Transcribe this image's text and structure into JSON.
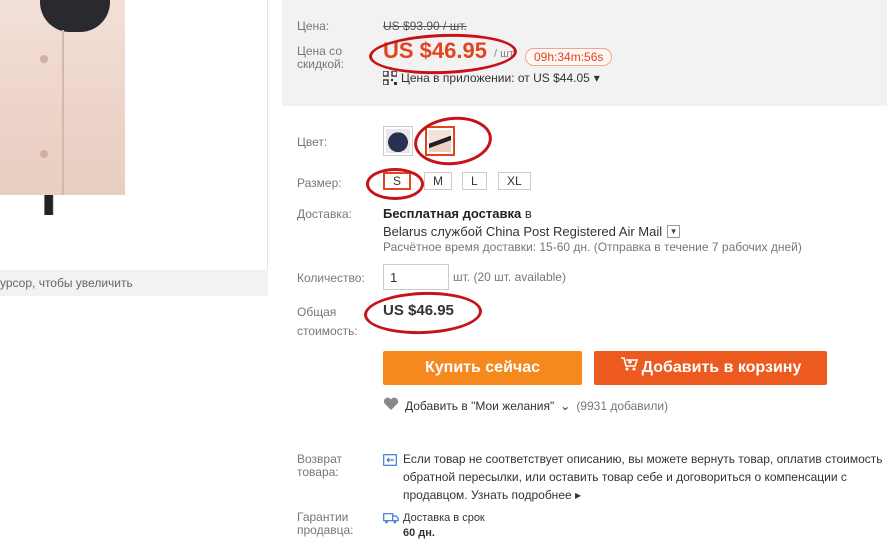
{
  "gallery": {
    "zoom_hint": "урсор, чтобы увеличить"
  },
  "price": {
    "label_price": "Цена:",
    "old_price": "US $93.90 / шт.",
    "label_discount_line1": "Цена со",
    "label_discount_line2": "скидкой:",
    "sale_price": "US $46.95",
    "per_unit": "/ шт.",
    "timer": "09h:34m:56s",
    "app_price": "Цена в приложении: от US $44.05",
    "app_price_dropdown": "▾"
  },
  "options": {
    "label_color": "Цвет:",
    "label_size": "Размер:",
    "sizes": [
      "S",
      "M",
      "L",
      "XL"
    ],
    "selected_size": "S",
    "label_shipping": "Доставка:",
    "shipping_free": "Бесплатная доставка",
    "shipping_to": "в",
    "shipping_via": "Belarus службой China Post Registered Air Mail",
    "shipping_eta": "Расчётное время доставки: 15-60 дн. (Отправка в течение 7 рабочих дней)",
    "label_quantity": "Количество:",
    "quantity": "1",
    "quantity_available": "шт. (20 шт. available)",
    "label_total_line1": "Общая",
    "label_total_line2": "стоимость:",
    "total": "US $46.95"
  },
  "actions": {
    "buy_now": "Купить сейчас",
    "add_to_cart": "Добавить в корзину",
    "wishlist": "Добавить в \"Мои желания\"",
    "wishlist_count": "(9931 добавили)"
  },
  "policies": {
    "label_return_line1": "Возврат",
    "label_return_line2": "товара:",
    "return_text": "Если товар не соответствует описанию, вы можете вернуть товар, оплатив стоимость обратной пересылки, или оставить товар себе и договориться о компенсации с продавцом.",
    "return_more": "Узнать подробнее",
    "label_guarantee_line1": "Гарантии",
    "label_guarantee_line2": "продавца:",
    "delivery_on_time": "Доставка в срок",
    "delivery_days": "60 дн."
  },
  "colors": {
    "accent_orange": "#f5891e",
    "accent_red": "#ed5a1f",
    "price_red": "#e2441e",
    "annotation_red": "#c8121a"
  }
}
